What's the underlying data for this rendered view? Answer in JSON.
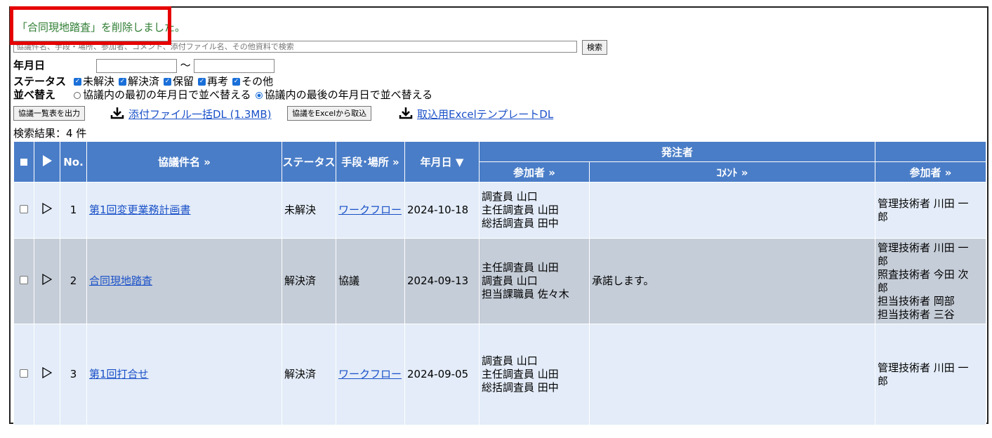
{
  "message": "「合同現地踏査」を削除しました。",
  "search": {
    "placeholder": "協議件名、手段・場所、参加者、コメント、添付ファイル名、その他資料で検索",
    "button": "検索"
  },
  "date_filter": {
    "label": "年月日",
    "separator": "～"
  },
  "status_filter": {
    "label": "ステータス",
    "options": [
      "未解決",
      "解決済",
      "保留",
      "再考",
      "その他"
    ]
  },
  "sort": {
    "label": "並べ替え",
    "options": [
      "協議内の最初の年月日で並べ替える",
      "協議内の最後の年月日で並べ替える"
    ],
    "selected_index": 1
  },
  "actions": {
    "export_button": "協議一覧表を出力",
    "attach_dl": "添付ファイル一括DL (1.3MB)",
    "import_button": "協議をExcelから取込",
    "template_dl": "取込用ExcelテンプレートDL"
  },
  "result_count": "検索結果：4 件",
  "table": {
    "headers": {
      "no": "No.",
      "subject": "協議件名 »",
      "status": "ステータス",
      "method": "手段･場所 »",
      "date": "年月日 ▼",
      "orderer_group": "発注者",
      "orderer_participants": "参加者 »",
      "orderer_comment": "ｺﾒﾝﾄ »",
      "contractor_participants": "参加者 »"
    },
    "rows": [
      {
        "no": "1",
        "subject": "第1回変更業務計画書",
        "status": "未解決",
        "method": "ワークフロー",
        "method_link": true,
        "date": "2024-10-18",
        "orderer": [
          "調査員 山口",
          "主任調査員 山田",
          "総括調査員 田中"
        ],
        "comment": "",
        "contractor": [
          "管理技術者 川田 一",
          "郎"
        ]
      },
      {
        "no": "2",
        "subject": "合同現地踏査",
        "status": "解決済",
        "method": "協議",
        "method_link": false,
        "date": "2024-09-13",
        "orderer": [
          "主任調査員 山田",
          "調査員 山口",
          "担当課職員 佐々木"
        ],
        "comment": "承諾します。",
        "contractor": [
          "管理技術者 川田 一",
          "郎",
          "照査技術者 今田 次",
          "郎",
          "担当技術者 岡部",
          "担当技術者 三谷"
        ]
      },
      {
        "no": "3",
        "subject": "第1回打合せ",
        "status": "解決済",
        "method": "ワークフロー",
        "method_link": true,
        "date": "2024-09-05",
        "orderer": [
          "調査員 山口",
          "主任調査員 山田",
          "総括調査員 田中"
        ],
        "comment": "",
        "contractor": [
          "管理技術者 川田 一",
          "郎"
        ]
      }
    ]
  }
}
